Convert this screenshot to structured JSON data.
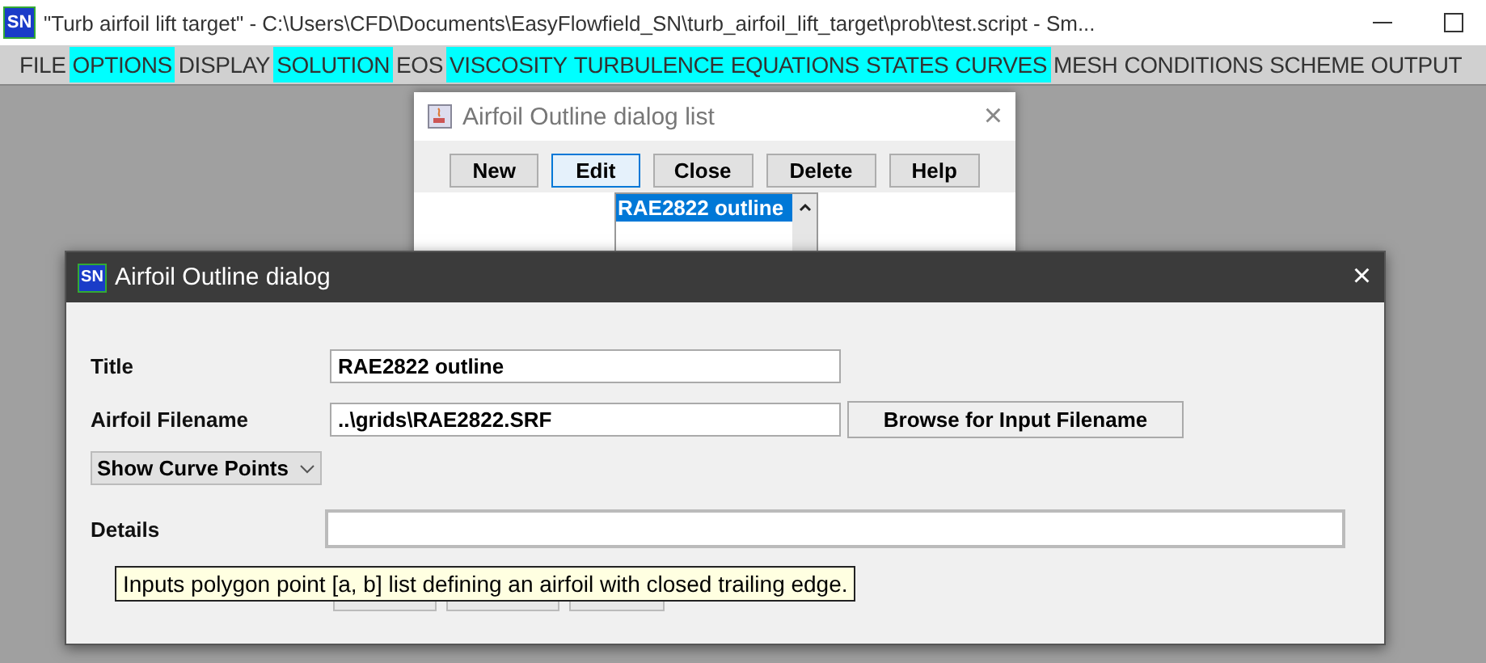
{
  "window": {
    "logo": "SN",
    "title": "\"Turb airfoil lift target\" - C:\\Users\\CFD\\Documents\\EasyFlowfield_SN\\turb_airfoil_lift_target\\prob\\test.script - Sm..."
  },
  "menu": [
    {
      "label": "FILE",
      "highlighted": false
    },
    {
      "label": "OPTIONS",
      "highlighted": true
    },
    {
      "label": "DISPLAY",
      "highlighted": false
    },
    {
      "label": "SOLUTION",
      "highlighted": true
    },
    {
      "label": "EOS",
      "highlighted": false
    },
    {
      "label": "VISCOSITY",
      "highlighted": true
    },
    {
      "label": "TURBULENCE",
      "highlighted": true
    },
    {
      "label": "EQUATIONS",
      "highlighted": true
    },
    {
      "label": "STATES",
      "highlighted": true
    },
    {
      "label": "CURVES",
      "highlighted": true
    },
    {
      "label": "MESH",
      "highlighted": false
    },
    {
      "label": "CONDITIONS",
      "highlighted": false
    },
    {
      "label": "SCHEME",
      "highlighted": false
    },
    {
      "label": "OUTPUT",
      "highlighted": false
    }
  ],
  "list_dialog": {
    "title": "Airfoil Outline dialog list",
    "close": "×",
    "buttons": [
      {
        "label": "New",
        "focused": false
      },
      {
        "label": "Edit",
        "focused": true
      },
      {
        "label": "Close",
        "focused": false
      },
      {
        "label": "Delete",
        "focused": false
      },
      {
        "label": "Help",
        "focused": false
      }
    ],
    "items": [
      {
        "label": "RAE2822 outline",
        "selected": true
      }
    ]
  },
  "dialog": {
    "logo": "SN",
    "title": "Airfoil Outline dialog",
    "close": "×",
    "fields": [
      {
        "label": "Title",
        "value": "RAE2822 outline"
      },
      {
        "label": "Airfoil Filename",
        "value": "..\\grids\\RAE2822.SRF"
      }
    ],
    "browse_button": "Browse for Input Filename",
    "dropdown": "Show Curve Points",
    "details_label": "Details",
    "tooltip": "Inputs polygon point [a, b] list defining an airfoil with closed trailing edge."
  }
}
